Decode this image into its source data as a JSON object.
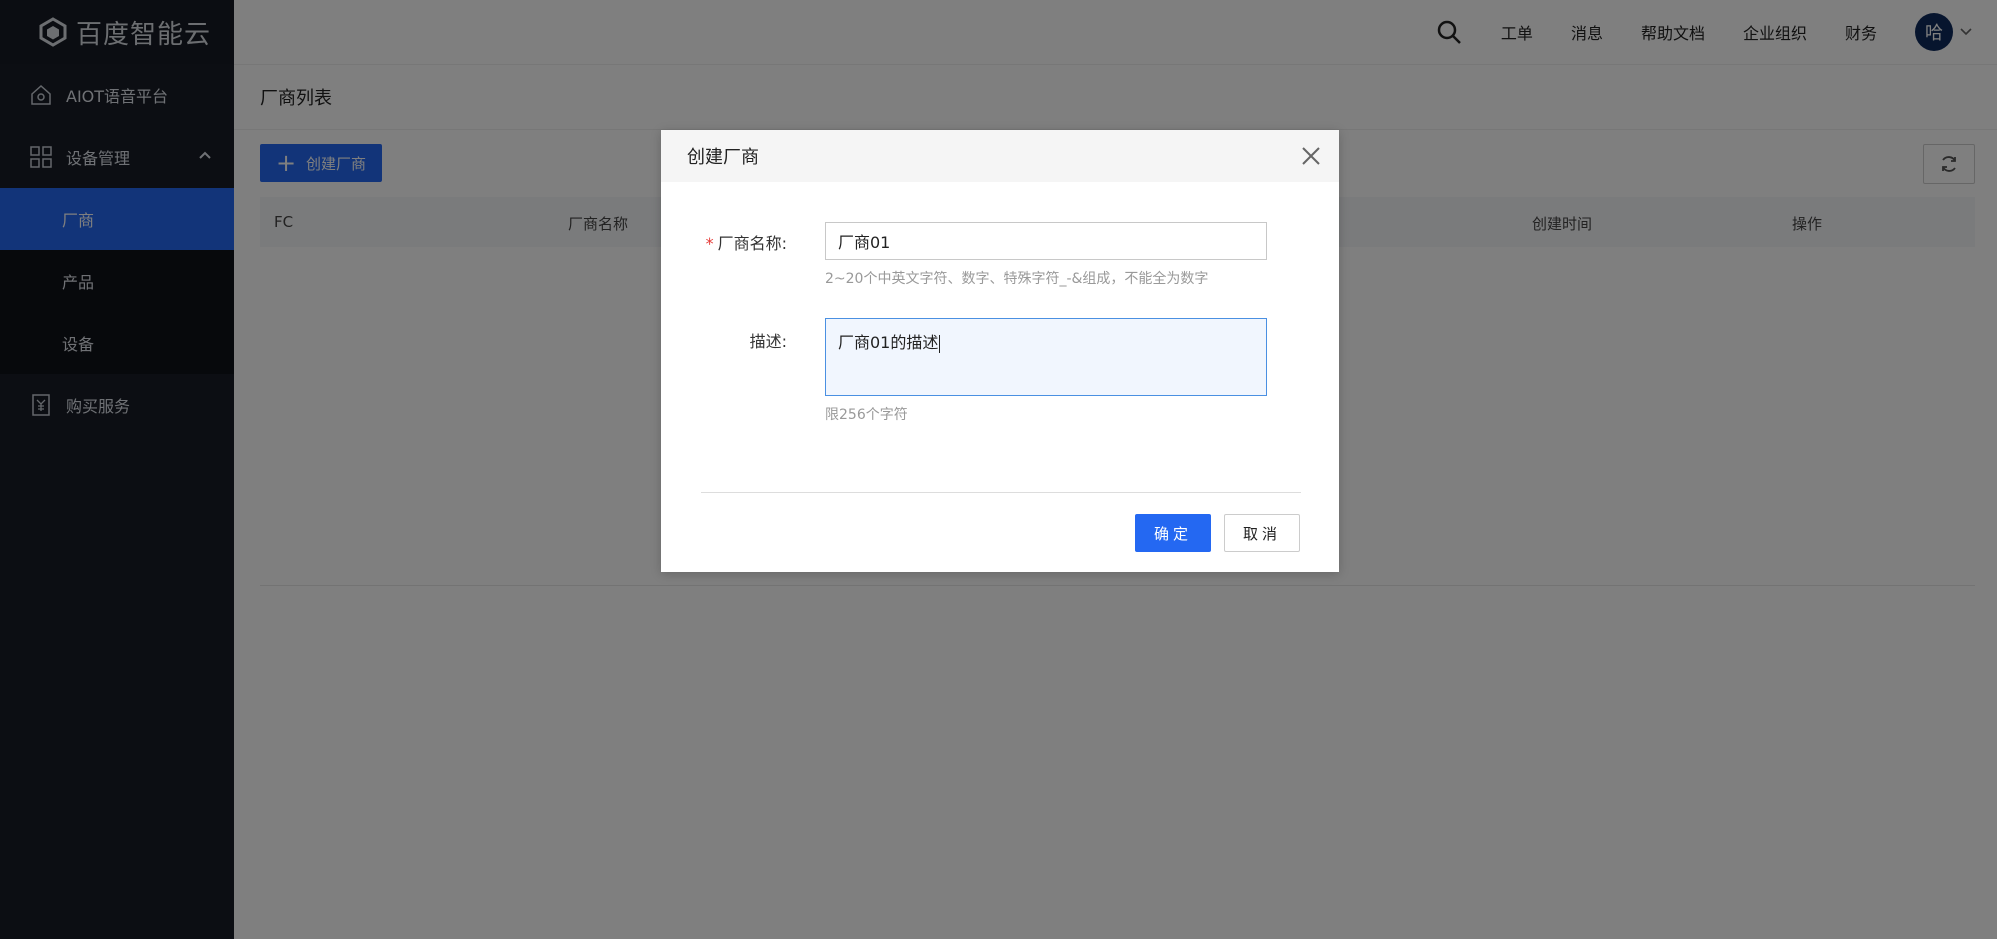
{
  "brand": {
    "name": "百度智能云",
    "icon": "baidu-cloud-logo-icon"
  },
  "sidebar": {
    "items": [
      {
        "label": "AIOT语音平台",
        "icon": "home-icon"
      },
      {
        "label": "设备管理",
        "icon": "grid-icon",
        "expanded": true,
        "children": [
          {
            "label": "厂商",
            "active": true
          },
          {
            "label": "产品"
          },
          {
            "label": "设备"
          }
        ]
      },
      {
        "label": "购买服务",
        "icon": "invoice-icon"
      }
    ]
  },
  "topbar": {
    "links": [
      "工单",
      "消息",
      "帮助文档",
      "企业组织",
      "财务"
    ],
    "avatar_text": "哈"
  },
  "page": {
    "title": "厂商列表",
    "create_button": "创建厂商",
    "table_headers": [
      "FC",
      "厂商名称",
      "创建时间",
      "操作"
    ]
  },
  "modal": {
    "title": "创建厂商",
    "name_label": "厂商名称:",
    "name_required_mark": "*",
    "name_value": "厂商01",
    "name_hint": "2~20个中英文字符、数字、特殊字符_-&组成，不能全为数字",
    "desc_label": "描述:",
    "desc_value": "厂商01的描述",
    "desc_hint": "限256个字符",
    "ok_label": "确定",
    "cancel_label": "取消"
  },
  "colors": {
    "primary": "#2468f2",
    "sidebar_bg": "#181d27",
    "required": "#e53935"
  }
}
